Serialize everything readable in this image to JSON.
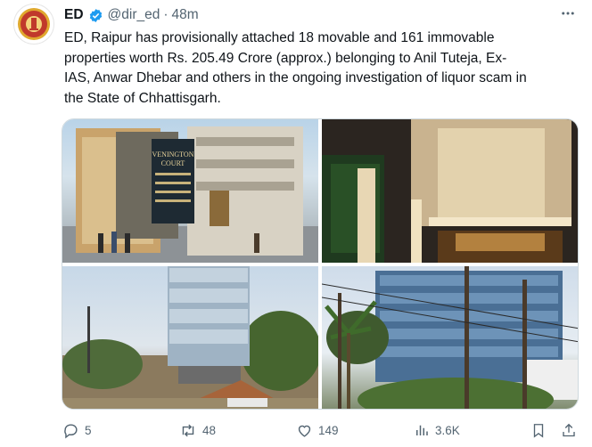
{
  "tweet": {
    "author_name": "ED",
    "handle": "@dir_ed",
    "separator": "·",
    "time": "48m",
    "text_lines": [
      "ED, Raipur has provisionally attached 18 movable and 161 immovable",
      "properties worth Rs. 205.49 Crore (approx.) belonging to Anil Tuteja, Ex-",
      "IAS, Anwar Dhebar and others in the ongoing investigation of liquor scam in",
      "the State of Chhattisgarh."
    ]
  },
  "images": {
    "sign_line1": "VENINGTON",
    "sign_line2": "COURT"
  },
  "actions": {
    "replies": "5",
    "reposts": "48",
    "likes": "149",
    "views": "3.6K"
  },
  "colors": {
    "verified": "#1d9bf0",
    "muted": "#536471",
    "seal_red": "#c0392b",
    "seal_gold": "#e0a82e"
  },
  "icons": [
    "more-icon",
    "verified-icon",
    "reply-icon",
    "repost-icon",
    "like-icon",
    "views-icon",
    "bookmark-icon",
    "share-icon"
  ]
}
